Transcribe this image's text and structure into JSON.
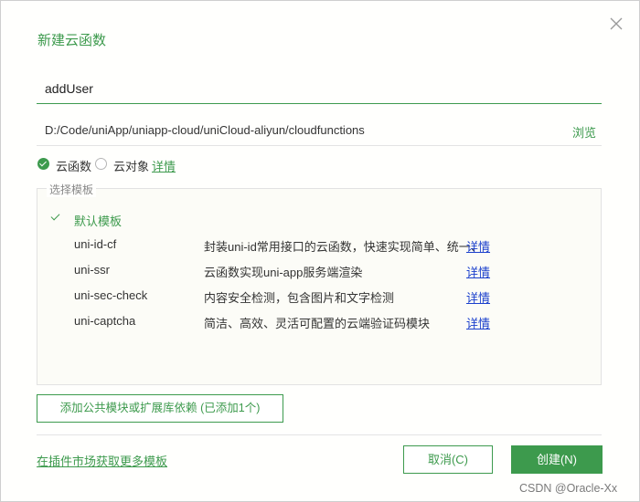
{
  "dialog": {
    "title": "新建云函数",
    "name_value": "addUser",
    "path": "D:/Code/uniApp/uniapp-cloud/uniCloud-aliyun/cloudfunctions",
    "browse_label": "浏览"
  },
  "type_options": {
    "cloud_function_label": "云函数",
    "cloud_object_label": "云对象",
    "details_link": "详情",
    "selected": "云函数"
  },
  "templates": {
    "legend": "选择模板",
    "default_label": "默认模板",
    "items": [
      {
        "name": "uni-id-cf",
        "description": "封装uni-id常用接口的云函数，快速实现简单、统一、",
        "link": "详情"
      },
      {
        "name": "uni-ssr",
        "description": "云函数实现uni-app服务端渲染",
        "link": "详情"
      },
      {
        "name": "uni-sec-check",
        "description": "内容安全检测，包含图片和文字检测",
        "link": "详情"
      },
      {
        "name": "uni-captcha",
        "description": "简洁、高效、灵活可配置的云端验证码模块",
        "link": "详情"
      }
    ]
  },
  "add_module_label": "添加公共模块或扩展库依赖 (已添加1个)",
  "market_link": "在插件市场获取更多模板",
  "buttons": {
    "cancel": "取消(C)",
    "create": "创建(N)"
  },
  "watermark": "CSDN @Oracle-Xx",
  "colors": {
    "accent": "#3d9a4d",
    "link_blue": "#1a3fcc"
  },
  "icons": {
    "close": "close-icon",
    "checked_radio": "check-circle-icon",
    "default_check": "checkmark-icon"
  }
}
